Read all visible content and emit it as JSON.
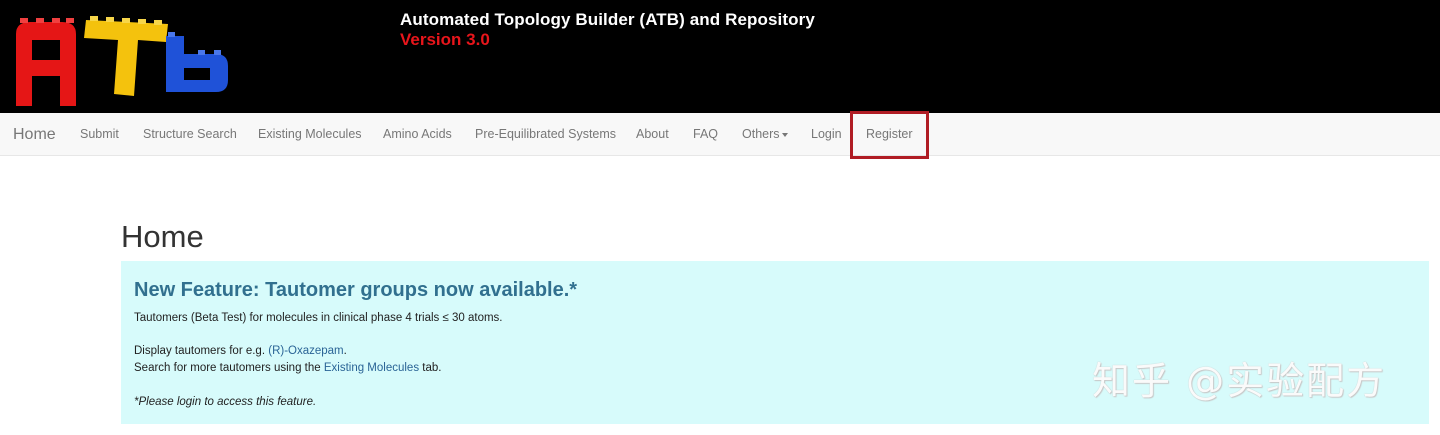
{
  "header": {
    "logo_text": "ATb",
    "title": "Automated Topology Builder (ATB) and Repository",
    "version": "Version 3.0"
  },
  "nav": {
    "brand": "Home",
    "items": [
      {
        "label": "Submit"
      },
      {
        "label": "Structure Search"
      },
      {
        "label": "Existing Molecules"
      },
      {
        "label": "Amino Acids"
      },
      {
        "label": "Pre-Equilibrated Systems"
      },
      {
        "label": "About"
      },
      {
        "label": "FAQ"
      },
      {
        "label": "Others"
      },
      {
        "label": "Login"
      },
      {
        "label": "Register"
      }
    ]
  },
  "main": {
    "page_title": "Home",
    "alert": {
      "heading": "New Feature: Tautomer groups now available.*",
      "line1": "Tautomers (Beta Test) for molecules in clinical phase 4 trials ≤ 30 atoms.",
      "line2_prefix": "Display tautomers for e.g. ",
      "line2_link": "(R)-Oxazepam",
      "line2_suffix": ".",
      "line3_prefix": "Search for more tautomers using the ",
      "line3_link": "Existing Molecules",
      "line3_suffix": " tab.",
      "note": "*Please login to access this feature."
    }
  },
  "watermark": "知乎 @实验配方",
  "colors": {
    "header_bg": "#000000",
    "version_red": "#e8151b",
    "alert_bg": "#d7fbfb",
    "alert_heading": "#31708f",
    "link": "#2a6496",
    "highlight_box": "#b01c24"
  }
}
